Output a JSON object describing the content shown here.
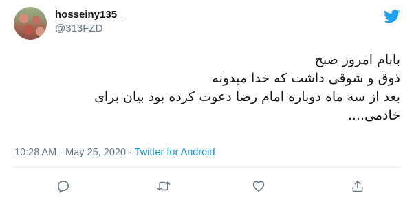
{
  "author": {
    "display_name": "hosseiny135_",
    "handle": "@313FZD",
    "avatar_icon": "avatar-image"
  },
  "tweet": {
    "lines": [
      "بابام امروز صبح",
      "ذوق و شوقی داشت که خدا میدونه",
      "بعد از سه ماه دوباره امام رضا دعوت کرده بود بیان برای",
      "خادمی...."
    ]
  },
  "meta": {
    "time": "10:28 AM",
    "separator": " · ",
    "date": "May 25, 2020",
    "source": "Twitter for Android"
  },
  "actions": {
    "reply_icon": "reply-icon",
    "retweet_icon": "retweet-icon",
    "like_icon": "heart-icon",
    "share_icon": "share-icon"
  },
  "colors": {
    "brand": "#1da1f2",
    "link": "#1b95e0",
    "secondary_text": "#657786",
    "icon": "#657786"
  }
}
